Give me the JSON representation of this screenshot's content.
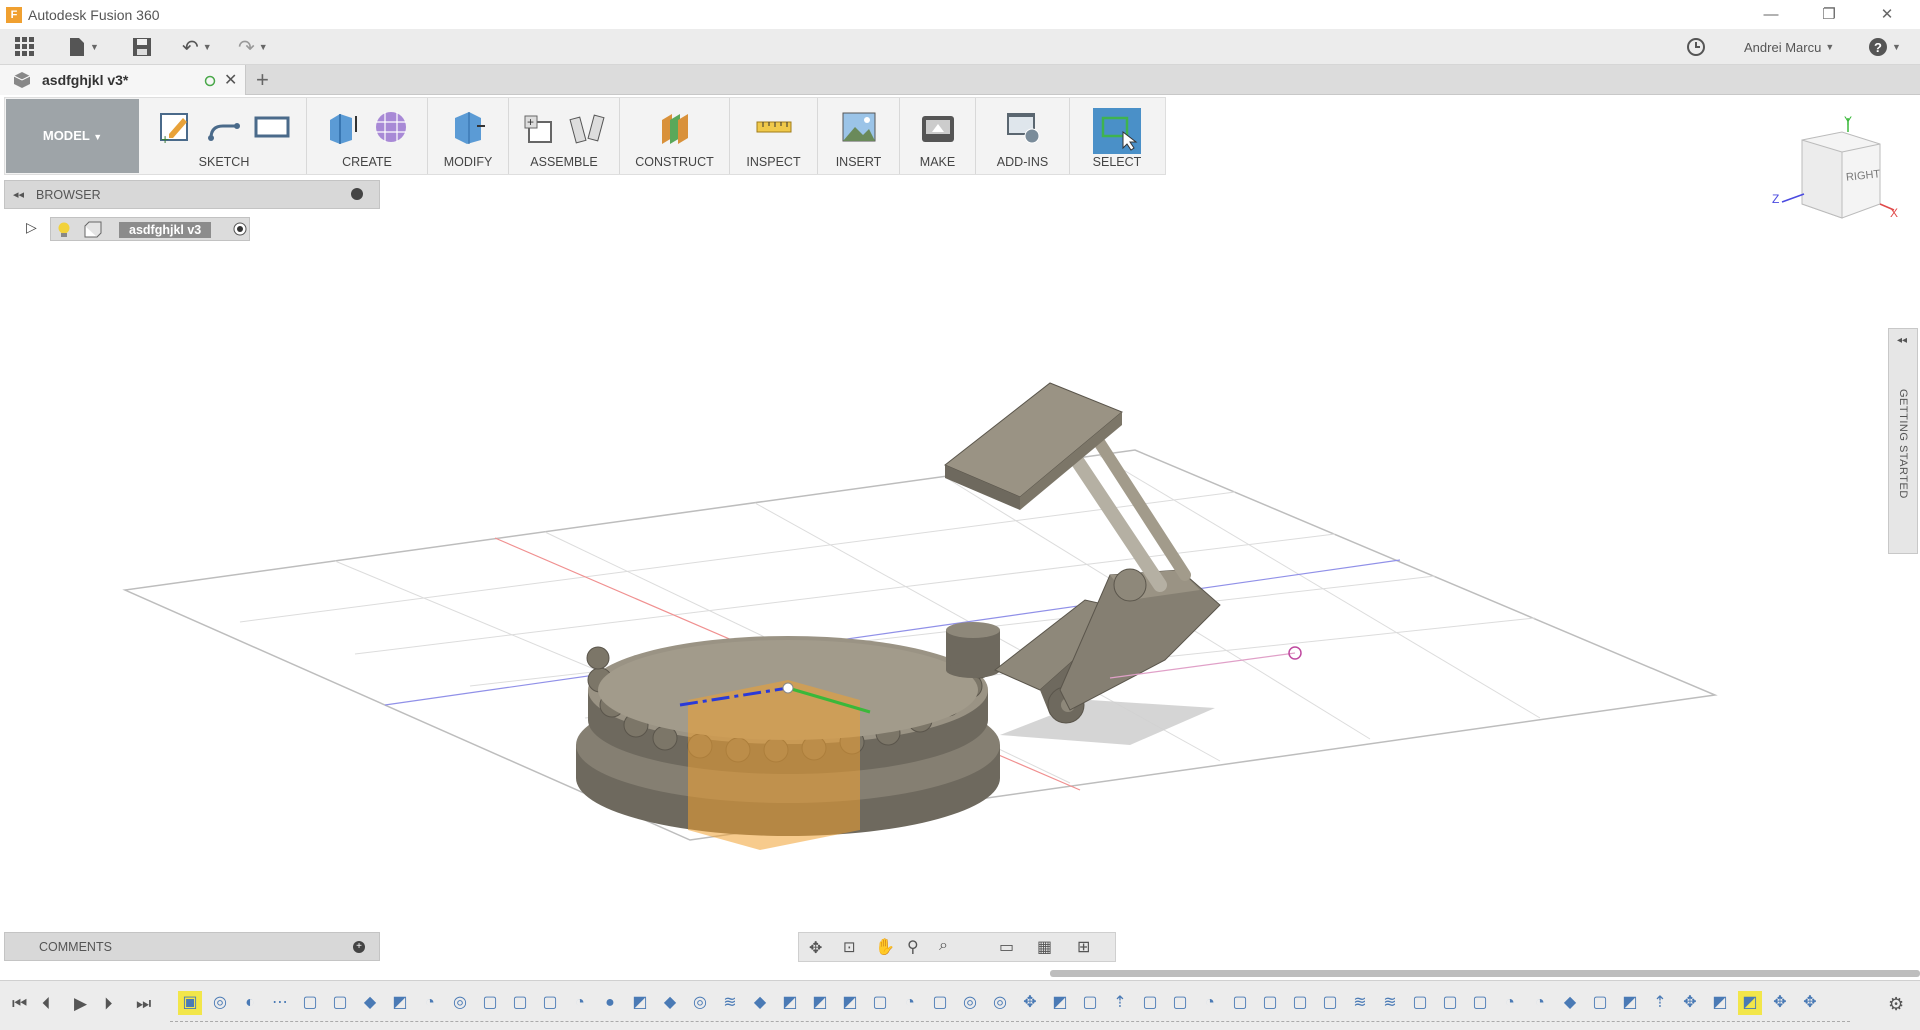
{
  "app": {
    "title": "Autodesk Fusion 360",
    "icon_letter": "F"
  },
  "qat": {
    "user": "Andrei Marcu"
  },
  "document": {
    "tab_name": "asdfghjkl v3*"
  },
  "toolbar": {
    "workspace": "MODEL",
    "groups": [
      "SKETCH",
      "CREATE",
      "MODIFY",
      "ASSEMBLE",
      "CONSTRUCT",
      "INSPECT",
      "INSERT",
      "MAKE",
      "ADD-INS",
      "SELECT"
    ]
  },
  "browser": {
    "label": "BROWSER",
    "root_node": "asdfghjkl v3"
  },
  "comments": {
    "label": "COMMENTS"
  },
  "viewcube": {
    "face": "RIGHT",
    "axis_y": "Y",
    "axis_z": "Z",
    "axis_x": "X"
  },
  "side_panel": {
    "label": "GETTING STARTED"
  },
  "colors": {
    "accent": "#4a90c8",
    "model_btn": "#9ea4a8",
    "part": "#7d776a"
  }
}
